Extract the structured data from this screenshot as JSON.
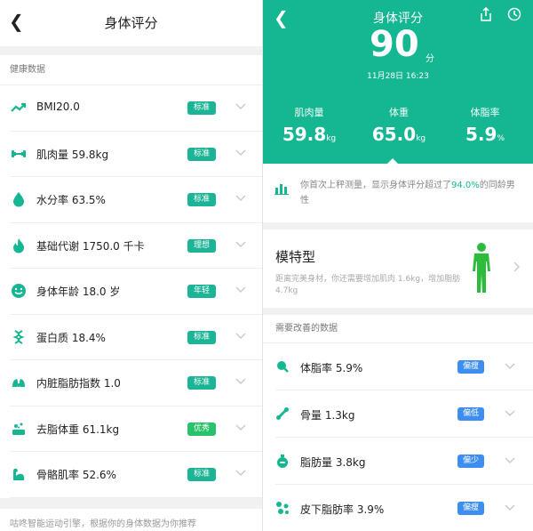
{
  "left": {
    "title": "身体评分",
    "section_label": "健康数据",
    "items": [
      {
        "label": "BMI20.0",
        "badge": "标准",
        "icon": "trend-up-icon"
      },
      {
        "label": "肌肉量 59.8kg",
        "badge": "标准",
        "icon": "dumbbell-icon"
      },
      {
        "label": "水分率 63.5%",
        "badge": "标准",
        "icon": "water-drop-icon"
      },
      {
        "label": "基础代谢 1750.0 千卡",
        "badge": "理想",
        "icon": "flame-icon"
      },
      {
        "label": "身体年龄 18.0 岁",
        "badge": "年轻",
        "icon": "smile-icon"
      },
      {
        "label": "蛋白质 18.4%",
        "badge": "标准",
        "icon": "protein-icon"
      },
      {
        "label": "内脏脂肪指数 1.0",
        "badge": "标准",
        "icon": "visceral-icon"
      },
      {
        "label": "去脂体重 61.1kg",
        "badge": "优秀",
        "icon": "lean-mass-icon"
      },
      {
        "label": "骨骼肌率 52.6%",
        "badge": "标准",
        "icon": "arm-muscle-icon"
      }
    ],
    "footer": "咕咚智能运动引擎，根据你的身体数据为你推荐"
  },
  "right": {
    "title": "身体评分",
    "score": "90",
    "score_unit": "分",
    "datetime": "11月28日 16:23",
    "stats": [
      {
        "label": "肌肉量",
        "value": "59.8",
        "unit": "kg"
      },
      {
        "label": "体重",
        "value": "65.0",
        "unit": "kg"
      },
      {
        "label": "体脂率",
        "value": "5.9",
        "unit": "%"
      }
    ],
    "compare_text_before": "你首次上秤测量，显示身体评分超过了",
    "compare_pct": "94.0%",
    "compare_text_after": "的同龄男性",
    "model_title": "模特型",
    "model_desc": "距离完美身材，你还需要增加肌肉 1.6kg，增加脂肪 4.7kg",
    "improve_label": "需要改善的数据",
    "improve_items": [
      {
        "label": "体脂率 5.9%",
        "badge": "偏瘦",
        "icon": "fat-rate-icon"
      },
      {
        "label": "骨量 1.3kg",
        "badge": "偏低",
        "icon": "bone-icon"
      },
      {
        "label": "脂肪量 3.8kg",
        "badge": "偏少",
        "icon": "fat-mass-icon"
      },
      {
        "label": "皮下脂肪率 3.9%",
        "badge": "偏瘦",
        "icon": "subcutaneous-fat-icon"
      }
    ]
  },
  "colors": {
    "accent": "#14b792",
    "badge_green": "#1cb496",
    "badge_excellent": "#28c26a",
    "badge_blue": "#3d8ef0",
    "figure_green": "#2dbb3c"
  }
}
